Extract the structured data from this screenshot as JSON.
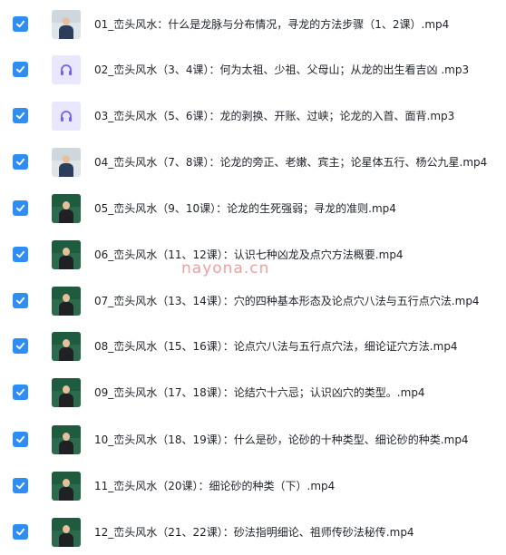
{
  "accent_color": "#2f8ef4",
  "files": [
    {
      "name": "01_峦头风水：什么是龙脉与分布情况，寻龙的方法步骤（1、2课）.mp4",
      "thumb": "video",
      "checked": true
    },
    {
      "name": "02_峦头风水（3、4课）：何为太祖、少祖、父母山；从龙的出生看吉凶 .mp3",
      "thumb": "audio",
      "checked": true
    },
    {
      "name": "03_峦头风水（5、6课）：龙的剥换、开账、过峡；论龙的入首、面背.mp3",
      "thumb": "audio",
      "checked": true
    },
    {
      "name": "04_峦头风水（7、8课）：论龙的旁正、老嫩、宾主；论星体五行、杨公九星.mp4",
      "thumb": "video",
      "checked": true
    },
    {
      "name": "05_峦头风水（9、10课）：论龙的生死强弱；寻龙的准则.mp4",
      "thumb": "video",
      "checked": true
    },
    {
      "name": "06_峦头风水（11、12课）：认识七种凶龙及点穴方法概要.mp4",
      "thumb": "video",
      "checked": true
    },
    {
      "name": "07_峦头风水（13、14课）：穴的四种基本形态及论点穴八法与五行点穴法.mp4",
      "thumb": "video",
      "checked": true
    },
    {
      "name": "08_峦头风水（15、16课）：论点穴八法与五行点穴法，细论证穴方法.mp4",
      "thumb": "video",
      "checked": true
    },
    {
      "name": "09_峦头风水（17、18课）：论结穴十六忌；认识凶穴的类型。.mp4",
      "thumb": "video",
      "checked": true
    },
    {
      "name": "10_峦头风水（18、19课）：什么是砂，论砂的十种类型、细论砂的种类.mp4",
      "thumb": "video",
      "checked": true
    },
    {
      "name": "11_峦头风水（20课）：细论砂的种类（下）.mp4",
      "thumb": "video",
      "checked": true
    },
    {
      "name": "12_峦头风水（21、22课）：砂法指明细论、祖师传砂法秘传.mp4",
      "thumb": "video",
      "checked": true
    }
  ],
  "icons": {
    "checkbox": "check-icon",
    "audio": "headphones-icon"
  },
  "watermark": "nayona.cn"
}
